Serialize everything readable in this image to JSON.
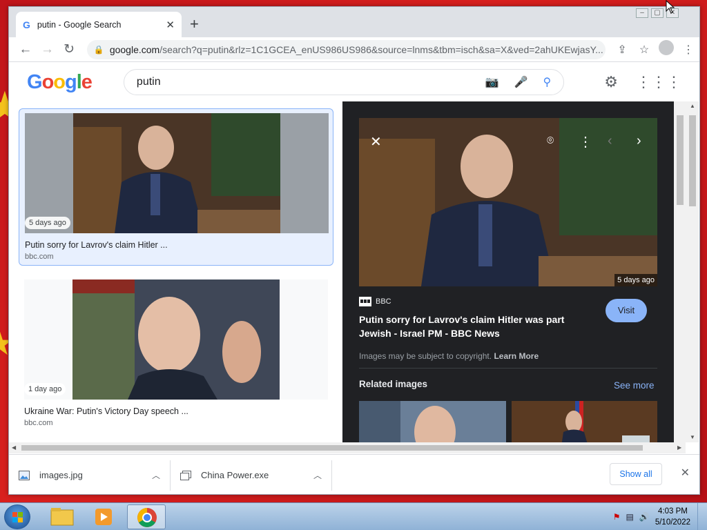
{
  "browser": {
    "tab_title": "putin - Google Search",
    "favicon": "google-g-icon",
    "url_main": "google.com",
    "url_rest": "/search?q=putin&rlz=1C1GCEA_enUS986US986&source=lnms&tbm=isch&sa=X&ved=2ahUKEwjasY..."
  },
  "google": {
    "query": "putin"
  },
  "results": [
    {
      "age": "5 days ago",
      "title": "Putin sorry for Lavrov's claim Hitler ...",
      "source": "bbc.com"
    },
    {
      "age": "1 day ago",
      "title": "Ukraine War: Putin's Victory Day speech ...",
      "source": "bbc.com"
    }
  ],
  "preview": {
    "age": "5 days ago",
    "source": "BBC",
    "title": "Putin sorry for Lavrov's claim Hitler was part Jewish - Israel PM - BBC News",
    "visit_label": "Visit",
    "copyright_text": "Images may be subject to copyright.",
    "learn_more": "Learn More",
    "related_heading": "Related images",
    "see_more": "See more"
  },
  "downloads": {
    "items": [
      {
        "name": "images.jpg"
      },
      {
        "name": "China Power.exe"
      }
    ],
    "show_all": "Show all"
  },
  "taskbar": {
    "time": "4:03 PM",
    "date": "5/10/2022"
  },
  "colors": {
    "accent": "#1a73e8",
    "panel_bg": "#202124",
    "visit_btn": "#8ab4f8",
    "selected_card": "#e8f0fe"
  }
}
